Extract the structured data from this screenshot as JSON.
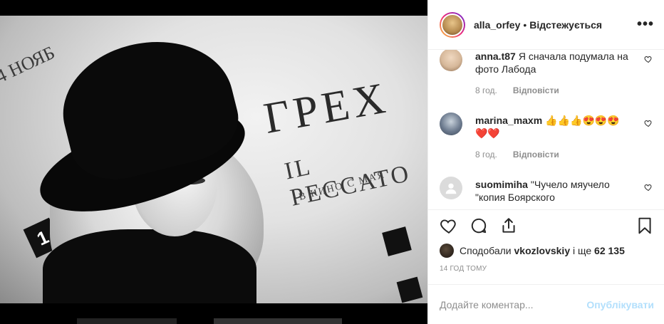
{
  "post": {
    "username": "alla_orfey",
    "separator": "•",
    "follow_status": "Відстежується",
    "more_icon": "more-horizontal-icon"
  },
  "photo": {
    "wall_title": "ГРЕХ",
    "wall_subtitle": "IL PECCATO",
    "wall_small": "В КИНО С МАЯ",
    "wall_left": "4 НОЯБ",
    "logo_text": "1"
  },
  "comments": [
    {
      "username": "anna.t87",
      "text": "Я сначала подумала на фото Лабода",
      "time": "8 год.",
      "reply_label": "Відповісти",
      "avatar_color": "#d6b89a"
    },
    {
      "username": "marina_maxm",
      "text": "👍👍👍😍😍😍 ❤️❤️",
      "time": "8 год.",
      "reply_label": "Відповісти",
      "avatar_color": "#6d7b8f"
    },
    {
      "username": "suomimiha",
      "text": "\"Чучело мяучело \"копия Боярского",
      "time": "",
      "reply_label": "",
      "avatar_color": "#dbdbdb"
    }
  ],
  "actions": {
    "like_icon": "heart-icon",
    "comment_icon": "comment-icon",
    "share_icon": "share-icon",
    "save_icon": "bookmark-icon"
  },
  "likes": {
    "prefix": "Сподобали",
    "user": "vkozlovskiy",
    "middle": "і ще",
    "count": "62 135"
  },
  "timestamp": "14 ГОД ТОМУ",
  "add_comment": {
    "placeholder": "Додайте коментар...",
    "publish_label": "Опублікувати"
  },
  "colors": {
    "text": "#262626",
    "muted": "#8e8e8e",
    "publish_disabled": "#b2dffc",
    "border": "#efefef"
  }
}
